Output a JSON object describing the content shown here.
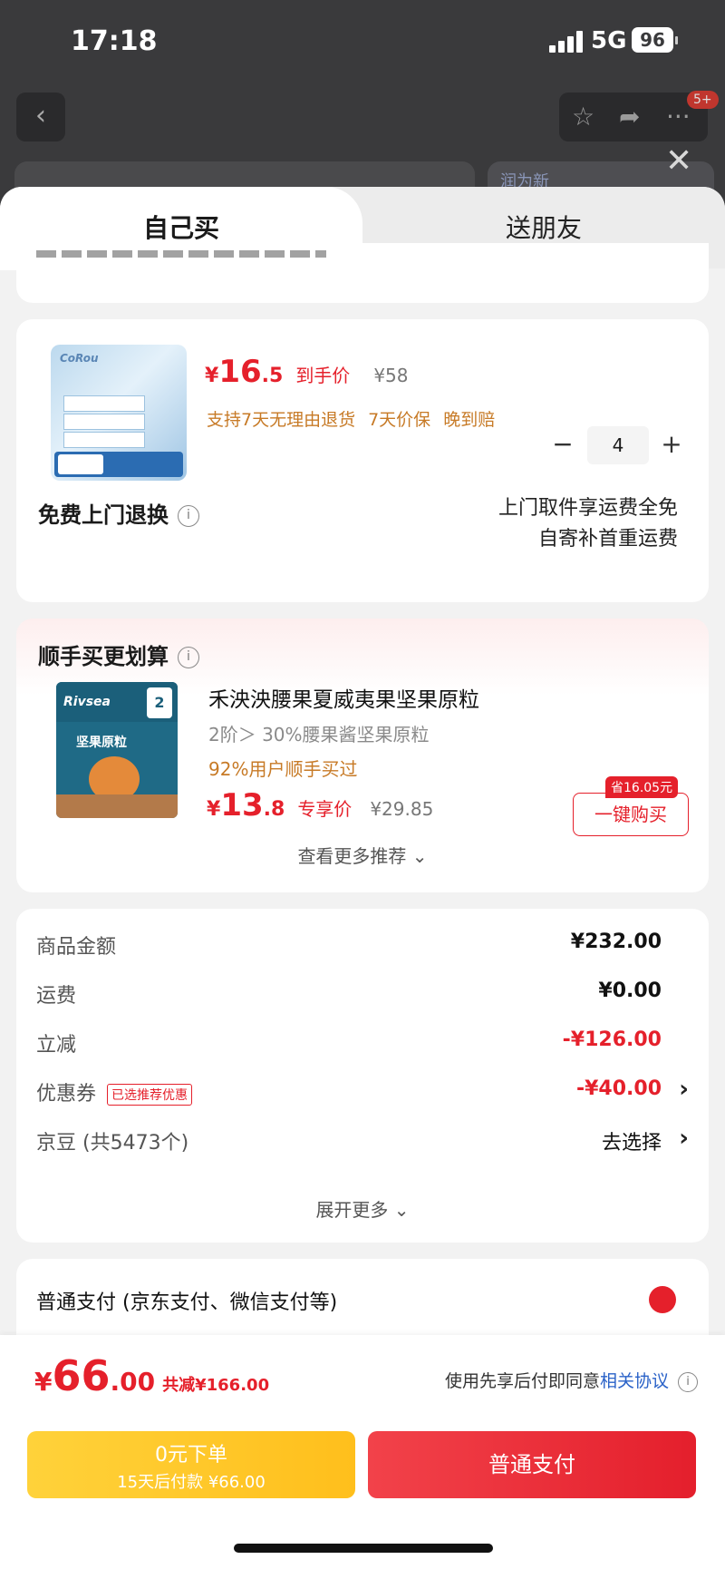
{
  "status": {
    "time": "17:18",
    "network": "5G",
    "battery": "96"
  },
  "background": {
    "badge": "5+",
    "brand_peek": "润为新"
  },
  "tabs": {
    "self": "自己买",
    "gift": "送朋友"
  },
  "product": {
    "price_yen": "¥",
    "price_int": "16",
    "price_dec": ".5",
    "price_tag": "到手价",
    "orig_price": "¥58",
    "guarantees": [
      "支持7天无理由退货",
      "7天价保",
      "晚到赔"
    ],
    "quantity": "4",
    "return_title": "免费上门退换",
    "return_note_1": "上门取件享运费全免",
    "return_note_2": "自寄补首重运费"
  },
  "recommend": {
    "title": "顺手买更划算",
    "name": "禾泱泱腰果夏威夷果坚果原粒",
    "spec": "2阶＞ 30%腰果酱坚果原粒",
    "bought": "92%用户顺手买过",
    "price_yen": "¥",
    "price_int": "13",
    "price_dec": ".8",
    "price_tag": "专享价",
    "orig_price": "¥29.85",
    "save_tag": "省16.05元",
    "buy_label": "一键购买",
    "more_label": "查看更多推荐 ⌄",
    "image_brand": "Rivsea",
    "image_label": "坚果原粒"
  },
  "summary": {
    "goods_label": "商品金额",
    "goods_value": "¥232.00",
    "shipping_label": "运费",
    "shipping_value": "¥0.00",
    "discount_label": "立减",
    "discount_value": "-¥126.00",
    "coupon_label": "优惠券",
    "coupon_tag": "已选推荐优惠",
    "coupon_value": "-¥40.00",
    "beans_label": "京豆 (共5473个)",
    "beans_value": "去选择",
    "expand_label": "展开更多 ⌄"
  },
  "payment": {
    "label": "普通支付 (京东支付、微信支付等)"
  },
  "bottom": {
    "total_yen": "¥",
    "total_int": "66",
    "total_dec": ".00",
    "total_saved": "共减¥166.00",
    "agree_text": "使用先享后付即同意",
    "agree_link": "相关协议",
    "later_line1": "0元下单",
    "later_line2": "15天后付款 ¥66.00",
    "pay_label": "普通支付"
  },
  "colors": {
    "accent": "#e5202b",
    "warning": "#c77a26",
    "link": "#2a62c8",
    "later": "#ffc72a"
  }
}
